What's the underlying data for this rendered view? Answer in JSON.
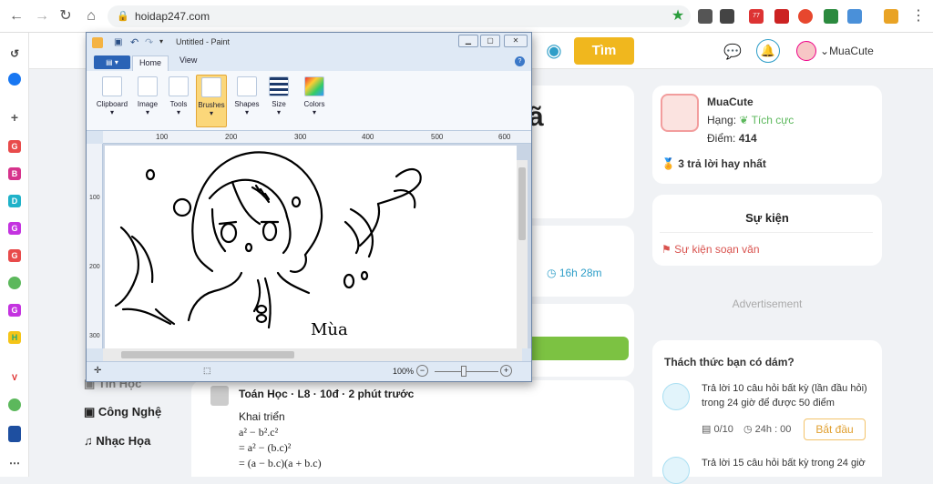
{
  "browser": {
    "url": "hoidap247.com",
    "ext_badge": "77"
  },
  "site": {
    "search_button": "Tìm",
    "username": "MuaCute",
    "heading_fragment": "ã",
    "timer": "16h  28m",
    "nav": [
      {
        "label": "Tin Học"
      },
      {
        "label": "Công Nghệ"
      },
      {
        "label": "Nhạc Họa"
      }
    ],
    "post": {
      "meta": "Toán Học · L8 · 10đ · 2 phút trước",
      "lines": [
        "Khai triển",
        "a² − b².c²",
        "= a² − (b.c)²",
        "= (a − b.c)(a + b.c)"
      ]
    },
    "profile": {
      "name": "MuaCute",
      "rank_label": "Hạng:",
      "rank_value": "Tích cực",
      "points_label": "Điểm:",
      "points_value": "414",
      "best": "3 trả lời hay nhất"
    },
    "events": {
      "title": "Sự kiện",
      "item": "Sự kiện soạn văn"
    },
    "advertisement": "Advertisement",
    "challenge": {
      "title": "Thách thức bạn có dám?",
      "task1": "Trả lời 10 câu hỏi  bất kỳ (lần đầu hỏi) trong 24 giờ để được 50 điểm",
      "progress": "0/10",
      "time": "24h : 00",
      "start_button": "Bắt đầu",
      "task2": "Trả lời 15 câu hỏi  bất kỳ  trong 24 giờ"
    }
  },
  "paint": {
    "title": "Untitled - Paint",
    "tabs": [
      "Home",
      "View"
    ],
    "groups": [
      "Clipboard",
      "Image",
      "Tools",
      "Brushes",
      "Shapes",
      "Size",
      "Colors"
    ],
    "ruler_h": [
      "100",
      "200",
      "300",
      "400",
      "500",
      "600"
    ],
    "ruler_v": [
      "100",
      "200",
      "300"
    ],
    "zoom": "100%",
    "canvas_text": "Mùa"
  },
  "colors": {
    "accent": "#2e9ec8",
    "search": "#f0b71e",
    "green": "#7cc242"
  }
}
